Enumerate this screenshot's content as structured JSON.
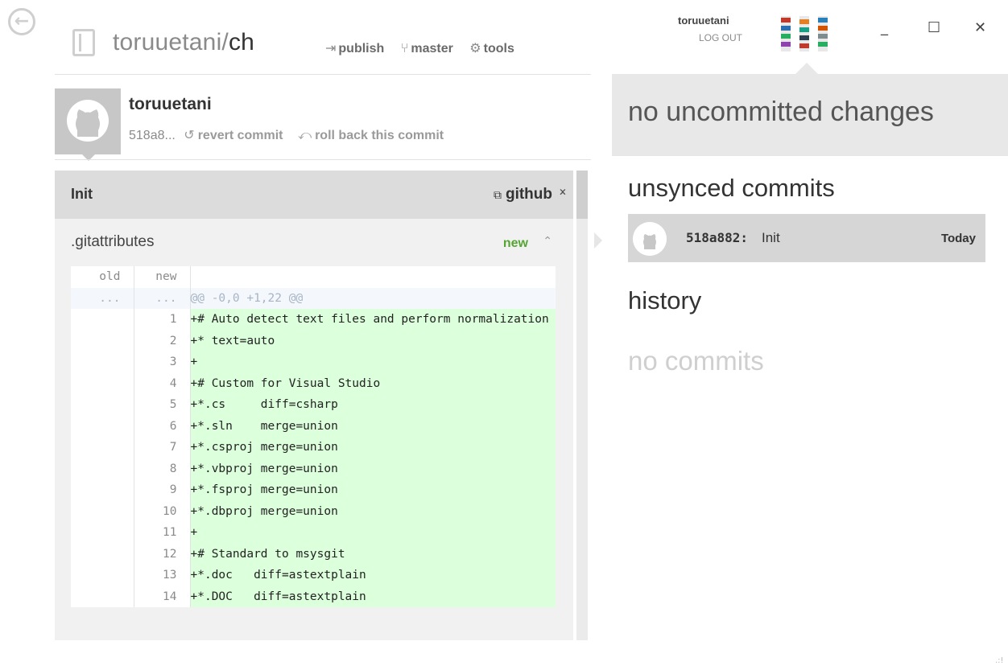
{
  "header": {
    "repo_owner": "toruuetani/",
    "repo_name": "ch",
    "toolbar": [
      {
        "glyph": "⇥",
        "label": "publish"
      },
      {
        "glyph": "⑂",
        "label": "master"
      },
      {
        "glyph": "⚙",
        "label": "tools"
      }
    ]
  },
  "user": {
    "name": "toruuetani",
    "logout_label": "LOG OUT"
  },
  "window": {
    "minimize": "_",
    "maximize": "☐",
    "close": "✕"
  },
  "commit": {
    "author": "toruuetani",
    "sha_short": "518a8...",
    "revert_label": "revert commit",
    "rollback_label": "roll back this commit",
    "message": "Init",
    "github_label": "github"
  },
  "file": {
    "name": ".gitattributes",
    "status": "new",
    "columns": {
      "old": "old",
      "new": "new"
    },
    "hunk": {
      "old": "...",
      "new": "...",
      "text": "@@ -0,0 +1,22 @@"
    },
    "lines": [
      {
        "n": "1",
        "text": "+# Auto detect text files and perform normalization"
      },
      {
        "n": "2",
        "text": "+* text=auto"
      },
      {
        "n": "3",
        "text": "+"
      },
      {
        "n": "4",
        "text": "+# Custom for Visual Studio"
      },
      {
        "n": "5",
        "text": "+*.cs     diff=csharp"
      },
      {
        "n": "6",
        "text": "+*.sln    merge=union"
      },
      {
        "n": "7",
        "text": "+*.csproj merge=union"
      },
      {
        "n": "8",
        "text": "+*.vbproj merge=union"
      },
      {
        "n": "9",
        "text": "+*.fsproj merge=union"
      },
      {
        "n": "10",
        "text": "+*.dbproj merge=union"
      },
      {
        "n": "11",
        "text": "+"
      },
      {
        "n": "12",
        "text": "+# Standard to msysgit"
      },
      {
        "n": "13",
        "text": "+*.doc   diff=astextplain"
      },
      {
        "n": "14",
        "text": "+*.DOC   diff=astextplain"
      }
    ]
  },
  "sidebar": {
    "changes_text": "no uncommitted changes",
    "unsynced_title": "unsynced commits",
    "unsynced": [
      {
        "sha": "518a882:",
        "message": "Init",
        "when": "Today"
      }
    ],
    "history_title": "history",
    "history_empty": "no commits"
  },
  "colors": {
    "added_line_bg": "#dcffdc",
    "new_status": "#55a532",
    "panel_grey": "#dcdcdc"
  }
}
